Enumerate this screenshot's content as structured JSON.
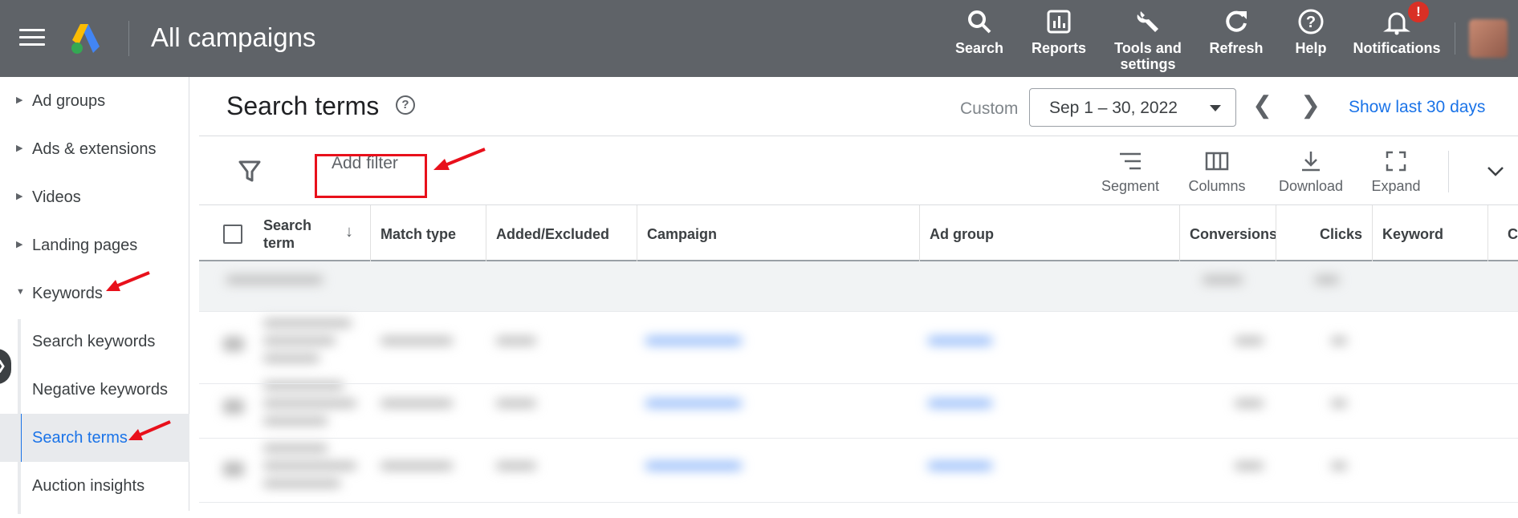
{
  "app": {
    "title": "All campaigns"
  },
  "topbar": {
    "tools": [
      {
        "label": "Search",
        "icon": "search-icon"
      },
      {
        "label": "Reports",
        "icon": "reports-icon"
      },
      {
        "label": "Tools and settings",
        "icon": "wrench-icon"
      },
      {
        "label": "Refresh",
        "icon": "refresh-icon"
      },
      {
        "label": "Help",
        "icon": "help-icon"
      },
      {
        "label": "Notifications",
        "icon": "bell-icon"
      }
    ],
    "notification_badge": "!"
  },
  "sidebar": {
    "items": [
      {
        "label": "Ad groups"
      },
      {
        "label": "Ads & extensions"
      },
      {
        "label": "Videos"
      },
      {
        "label": "Landing pages"
      },
      {
        "label": "Keywords"
      }
    ],
    "subitems": [
      {
        "label": "Search keywords"
      },
      {
        "label": "Negative keywords"
      },
      {
        "label": "Search terms",
        "active": true
      },
      {
        "label": "Auction insights"
      }
    ]
  },
  "header": {
    "title": "Search terms",
    "help": "?",
    "date_mode": "Custom",
    "date_range": "Sep 1 – 30, 2022",
    "show_last": "Show last 30 days"
  },
  "toolbar": {
    "add_filter": "Add filter",
    "buttons": [
      {
        "label": "Segment",
        "icon": "segment-icon"
      },
      {
        "label": "Columns",
        "icon": "columns-icon"
      },
      {
        "label": "Download",
        "icon": "download-icon"
      },
      {
        "label": "Expand",
        "icon": "expand-icon"
      }
    ]
  },
  "table": {
    "columns": [
      "Search term",
      "Match type",
      "Added/Excluded",
      "Campaign",
      "Ad group",
      "Conversions",
      "Clicks",
      "Keyword",
      "C"
    ]
  },
  "colors": {
    "topbar": "#5f6368",
    "accent": "#1a73e8",
    "annotation": "#e8101b"
  }
}
